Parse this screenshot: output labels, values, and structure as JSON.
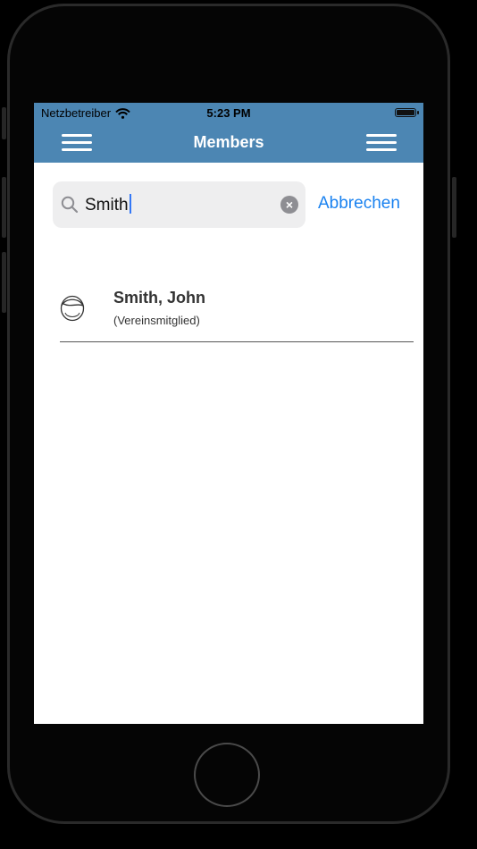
{
  "status_bar": {
    "carrier": "Netzbetreiber",
    "time": "5:23 PM",
    "wifi_icon": "wifi-icon",
    "battery_icon": "battery-icon"
  },
  "nav": {
    "title": "Members",
    "left_icon": "menu-icon",
    "right_icon": "menu-icon",
    "background": "#4c86b3"
  },
  "search": {
    "value": "Smith",
    "cancel_label": "Abbrechen",
    "search_icon": "search-icon",
    "clear_icon": "clear-icon",
    "accent": "#1a82f0"
  },
  "results": [
    {
      "name": "Smith, John",
      "role": "(Vereinsmitglied)",
      "icon": "avatar-icon"
    }
  ]
}
